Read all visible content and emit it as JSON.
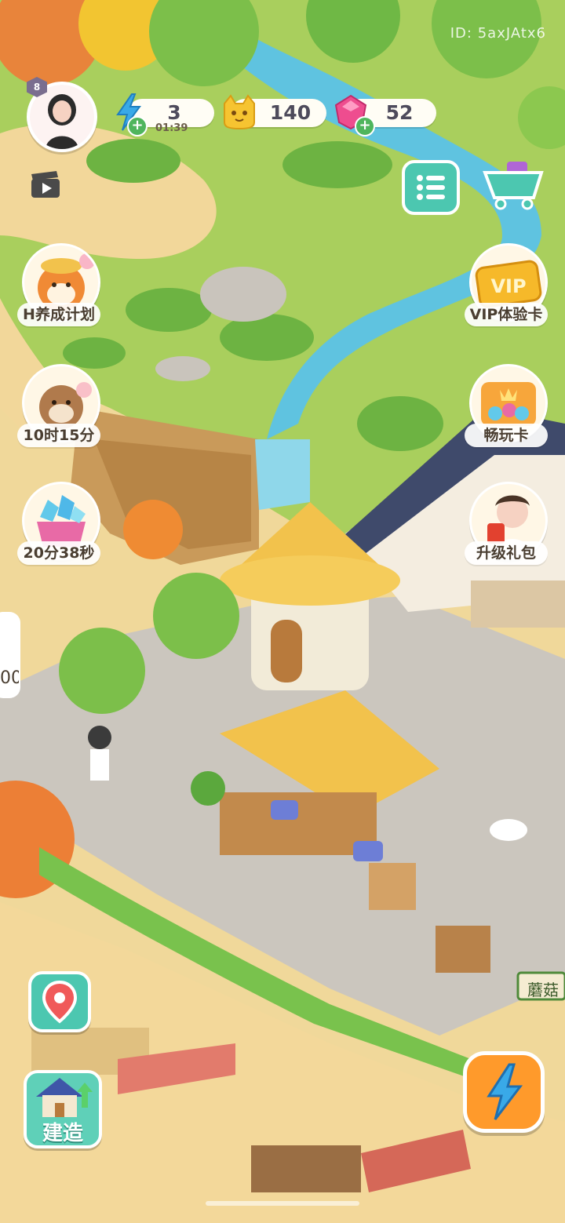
{
  "overlay": {
    "player_id": "ID: 5axJAtx6"
  },
  "hud": {
    "level": "8",
    "energy": {
      "value": "3",
      "timer": "01:39",
      "icon": "lightning-icon"
    },
    "coins": {
      "value": "140",
      "icon": "cat-coin-icon"
    },
    "gems": {
      "value": "52",
      "icon": "gem-icon"
    }
  },
  "left_features": [
    {
      "label": "H养成计划",
      "icon": "shiba-dog-icon"
    },
    {
      "label": "10时15分",
      "icon": "otter-icon"
    },
    {
      "label": "20分38秒",
      "icon": "gem-basket-icon"
    }
  ],
  "right_features": [
    {
      "label": "VIP体验卡",
      "icon": "vip-card-icon",
      "badge": "VIP"
    },
    {
      "label": "畅玩卡",
      "icon": "play-card-icon"
    },
    {
      "label": "升级礼包",
      "icon": "upgrade-gift-icon"
    }
  ],
  "edge_counter": "00",
  "sign": {
    "text": "蘑菇"
  },
  "bottom": {
    "build_label": "建造",
    "map_icon": "map-pin-icon",
    "energy_icon": "lightning-icon"
  },
  "colors": {
    "grass": "#9cc957",
    "path": "#f3d89a",
    "water": "#5fc3e0",
    "pavement": "#c9c4bd",
    "thatch": "#f2c24c",
    "teal_button": "#4cc7b0",
    "orange_button": "#ff9a2b"
  }
}
